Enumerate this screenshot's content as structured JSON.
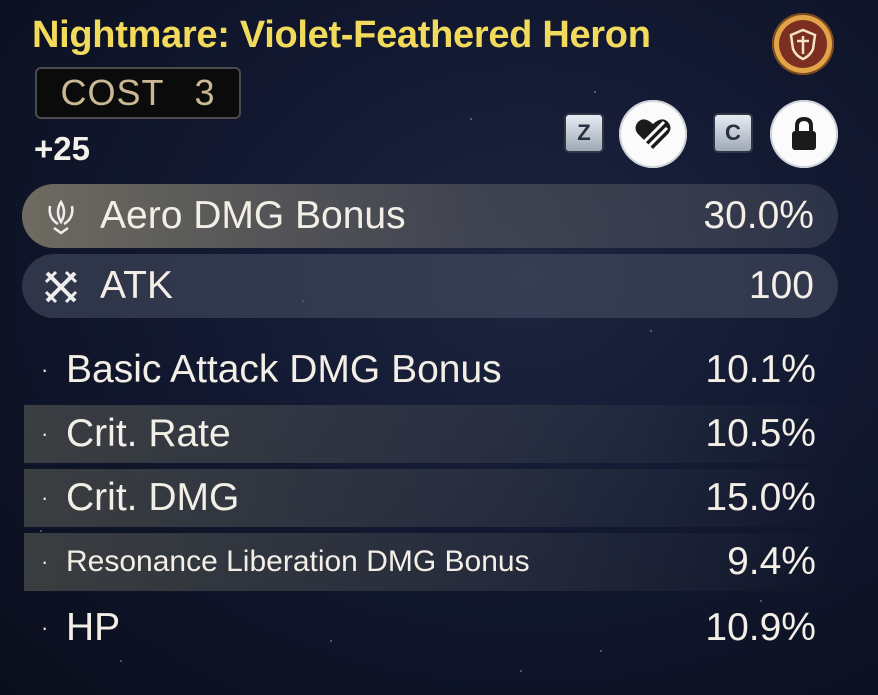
{
  "echo": {
    "name": "Nightmare: Violet-Feathered Heron",
    "cost_label": "COST",
    "cost_value": "3",
    "level": "+25",
    "emblem_icon": "faction-shield-icon"
  },
  "controls": {
    "discard_key": "Z",
    "discard_icon": "heart-slash-icon",
    "lock_key": "C",
    "lock_icon": "lock-icon"
  },
  "main_stats": [
    {
      "label": "Aero DMG Bonus",
      "value": "30.0%",
      "icon": "aero-element-icon"
    },
    {
      "label": "ATK",
      "value": "100",
      "icon": "crossed-swords-icon"
    }
  ],
  "sub_stats": [
    {
      "bullet": "·",
      "label": "Basic Attack DMG Bonus",
      "value": "10.1%"
    },
    {
      "bullet": "·",
      "label": "Crit. Rate",
      "value": "10.5%"
    },
    {
      "bullet": "·",
      "label": "Crit. DMG",
      "value": "15.0%"
    },
    {
      "bullet": "·",
      "label": "Resonance Liberation DMG Bonus",
      "value": "9.4%"
    },
    {
      "bullet": "·",
      "label": "HP",
      "value": "10.9%"
    }
  ],
  "colors": {
    "title": "#f2da5c",
    "background": "#121830",
    "cost_text": "#cbb994",
    "emblem_ring": "#e2a447",
    "emblem_inner": "#7c2f21"
  }
}
